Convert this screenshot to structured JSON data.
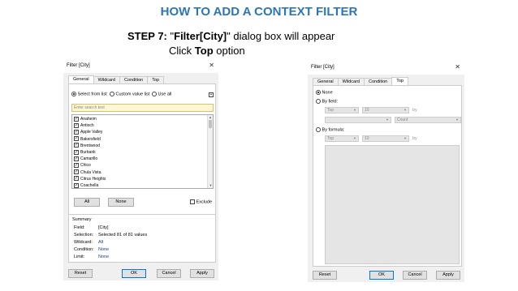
{
  "slide": {
    "title": "HOW TO ADD A CONTEXT FILTER",
    "step_bold": "STEP 7:",
    "step_q1": " \"",
    "step_name": "Filter[City]",
    "step_rest": "\" dialog box will appear",
    "click_pre": "Click ",
    "click_bold": "Top",
    "click_post": " option"
  },
  "left_dialog": {
    "title": "Filter [City]",
    "tabs": [
      "General",
      "Wildcard",
      "Condition",
      "Top"
    ],
    "active_tab": "General",
    "select_from_list": "Select from list",
    "custom_value_list": "Custom value list",
    "use_all": "Use all",
    "search_placeholder": "Enter search text",
    "items": [
      "Anaheim",
      "Antioch",
      "Apple Valley",
      "Bakersfield",
      "Brentwood",
      "Burbank",
      "Camarillo",
      "Chico",
      "Chula Vista",
      "Citrus Heights",
      "Coachella"
    ],
    "all_button": "All",
    "none_button": "None",
    "exclude": "Exclude",
    "summary_title": "Summary",
    "summary": [
      {
        "key": "Field:",
        "value": "[City]"
      },
      {
        "key": "Selection:",
        "value": "Selected 81 of 81 values"
      },
      {
        "key": "Wildcard:",
        "value": "All"
      },
      {
        "key": "Condition:",
        "value": "None"
      },
      {
        "key": "Limit:",
        "value": "None"
      }
    ],
    "buttons": {
      "reset": "Reset",
      "ok": "OK",
      "cancel": "Cancel",
      "apply": "Apply"
    }
  },
  "right_dialog": {
    "title": "Filter [City]",
    "tabs": [
      "General",
      "Wildcard",
      "Condition",
      "Top"
    ],
    "active_tab": "Top",
    "none": "None",
    "by_field": "By field:",
    "by_formula": "By formula:",
    "top_value": "Top",
    "count_value": "10",
    "by": "by",
    "agg_value": "Count",
    "buttons": {
      "reset": "Reset",
      "ok": "OK",
      "cancel": "Cancel",
      "apply": "Apply"
    }
  },
  "icons": {
    "close": "close-icon",
    "check": "check-icon",
    "dropdown": "chevron-down-icon",
    "clear": "clear-list-icon"
  }
}
